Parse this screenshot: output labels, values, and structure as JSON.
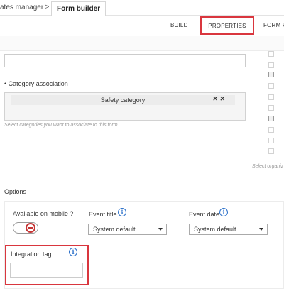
{
  "breadcrumb": {
    "items": [
      "ates manager",
      "Form builder"
    ],
    "separator": ">"
  },
  "tabs": [
    {
      "label": "BUILD",
      "active": false
    },
    {
      "label": "PROPERTIES",
      "active": true,
      "highlight": "#d9363e"
    },
    {
      "label": "FORM FL",
      "active": false
    }
  ],
  "category": {
    "label": "Category association",
    "required_marker": "•",
    "selected": "Safety category",
    "actions": "✕ ✕",
    "hint": "Select categories you want to associate to this form",
    "org_hint": "Select organiz",
    "checkboxes": [
      false,
      false,
      true,
      false,
      false,
      false,
      true,
      false,
      false,
      false
    ]
  },
  "options": {
    "title": "Options",
    "available_on_mobile": {
      "label": "Available on mobile ?",
      "value": false
    },
    "event_title": {
      "label": "Event title",
      "value": "System default"
    },
    "event_date": {
      "label": "Event date",
      "value": "System default"
    },
    "integration_tag": {
      "label": "Integration tag",
      "value": "",
      "highlight": "#d9363e"
    }
  },
  "icons": {
    "info": "info-icon",
    "caret": "caret-down-icon",
    "toggle_off": "toggle-off-icon"
  }
}
